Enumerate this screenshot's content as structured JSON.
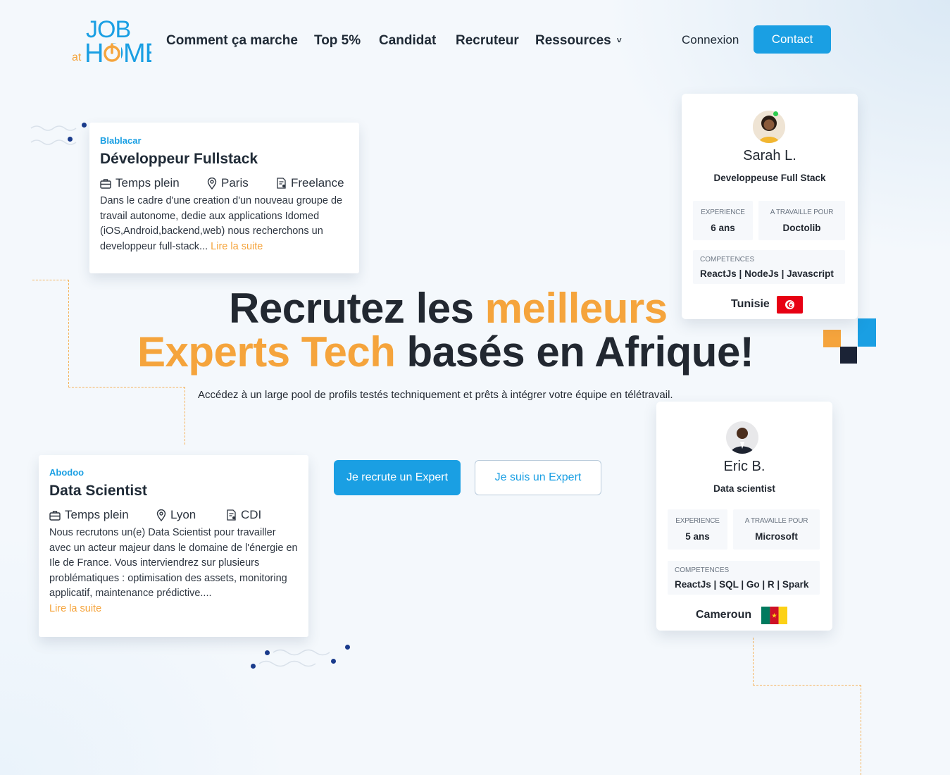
{
  "brand": {
    "logo_top": "JOB",
    "logo_at": "at",
    "logo_bottom": "HOME"
  },
  "nav": {
    "links": [
      "Comment ça marche",
      "Top 5%",
      "Candidat",
      "Recruteur",
      "Ressources"
    ],
    "login": "Connexion",
    "contact": "Contact"
  },
  "jobs": [
    {
      "company": "Blablacar",
      "title": "Développeur Fullstack",
      "type": "Temps plein",
      "location": "Paris",
      "contract": "Freelance",
      "description": "Dans le cadre d'une creation d'un nouveau groupe de travail autonome, dedie aux applications Idomed (iOS,Android,backend,web) nous recherchons un developpeur full-stack...",
      "read_more": "Lire la suite"
    },
    {
      "company": "Abodoo",
      "title": "Data Scientist",
      "type": "Temps plein",
      "location": "Lyon",
      "contract": "CDI",
      "description": "Nous recrutons un(e) Data Scientist pour travailler avec un acteur majeur dans le domaine de l'énergie en Ile de France. Vous interviendrez sur plusieurs problématiques : optimisation des assets, monitoring applicatif, maintenance prédictive....",
      "read_more": "Lire la suite"
    }
  ],
  "hero": {
    "line1_dark": "Recrutez les",
    "line1_orange": "meilleurs",
    "line2_orange": "Experts Tech",
    "line2_dark": "basés en Afrique!",
    "subtitle": "Accédez à un large pool de profils testés techniquement et prêts à intégrer votre équipe en télétravail.",
    "cta_primary": "Je recrute un Expert",
    "cta_secondary": "Je suis un Expert"
  },
  "profiles": [
    {
      "name": "Sarah L.",
      "role": "Developpeuse Full Stack",
      "experience_label": "EXPERIENCE",
      "experience": "6 ans",
      "worked_for_label": "A TRAVAILLE POUR",
      "worked_for": "Doctolib",
      "skills_label": "COMPETENCES",
      "skills": "ReactJs | NodeJs | Javascript",
      "country": "Tunisie"
    },
    {
      "name": "Eric B.",
      "role": "Data scientist",
      "experience_label": "EXPERIENCE",
      "experience": "5 ans",
      "worked_for_label": "A TRAVAILLE POUR",
      "worked_for": "Microsoft",
      "skills_label": "COMPETENCES",
      "skills": "ReactJs | SQL | Go | R | Spark",
      "country": "Cameroun"
    }
  ],
  "colors": {
    "accent": "#1a9fe3",
    "orange": "#f5a43c",
    "dark": "#222831",
    "navy": "#1a3b8c"
  },
  "icons": [
    "briefcase-icon",
    "location-pin-icon",
    "contract-icon",
    "chevron-down-icon"
  ]
}
